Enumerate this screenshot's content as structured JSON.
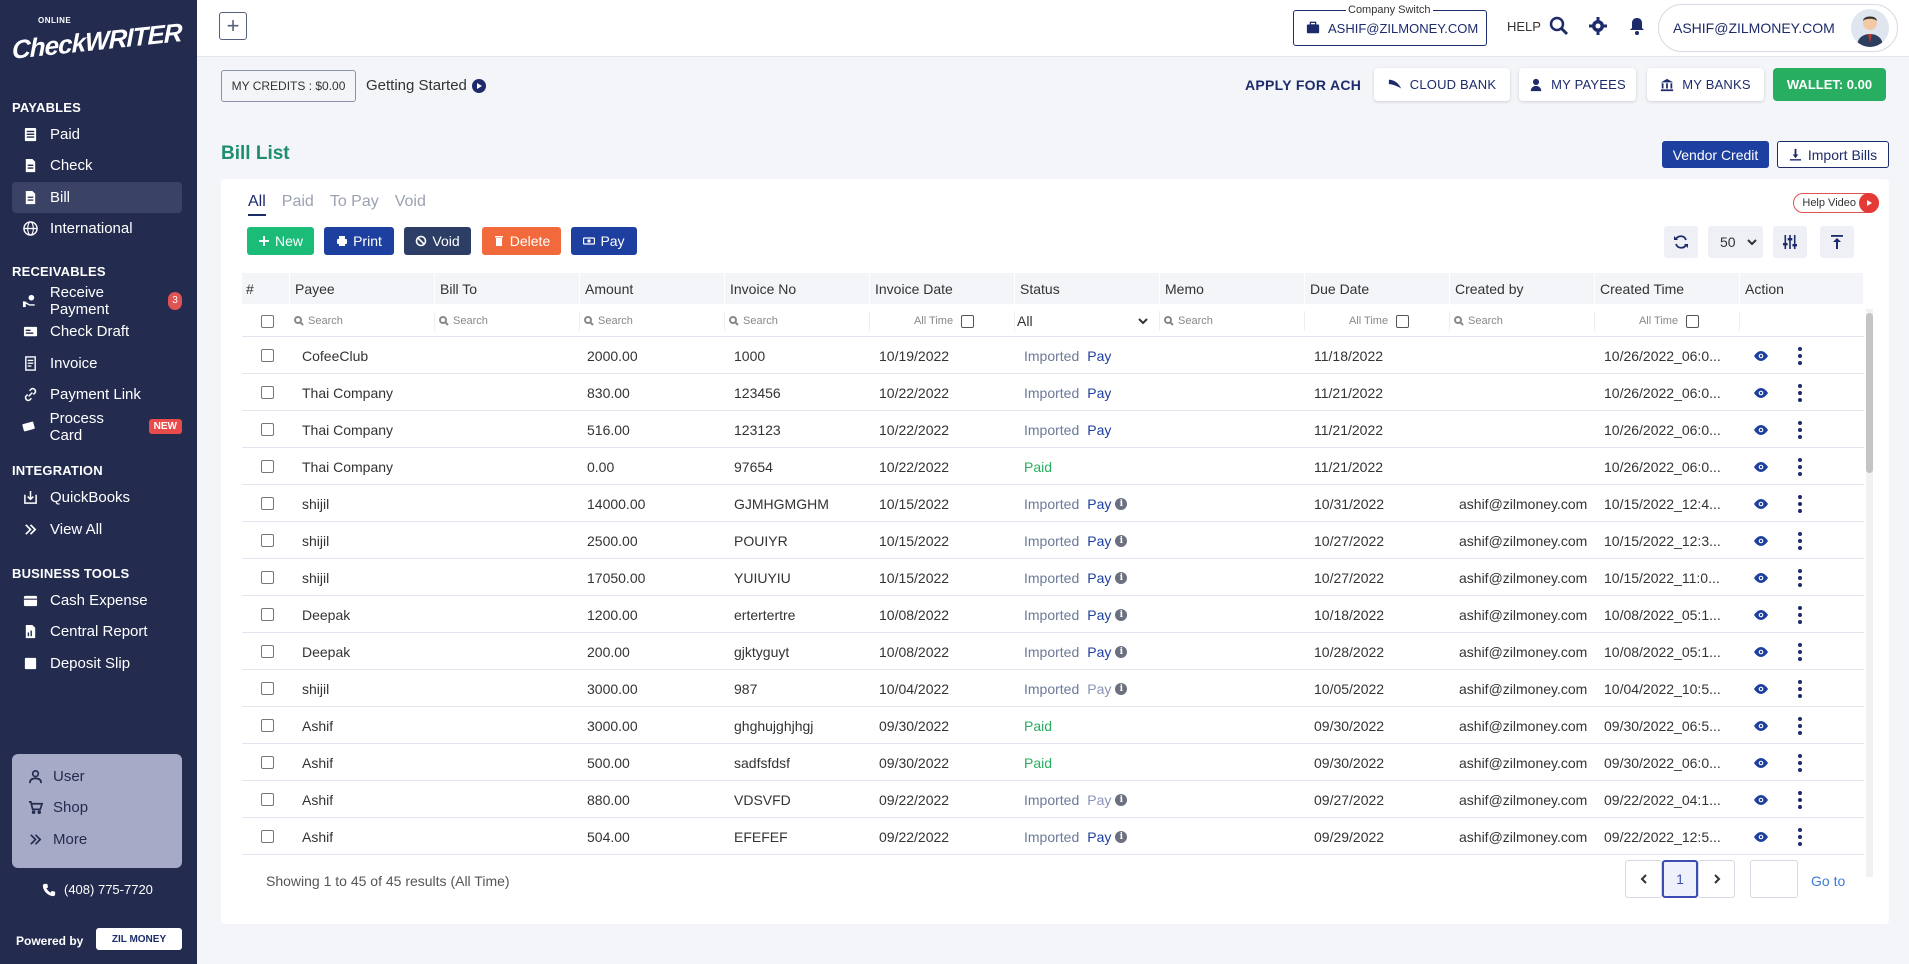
{
  "sidebar": {
    "logo_top": "ONLINE",
    "logo_brand": "CheckWRITER",
    "sections": {
      "payables": "PAYABLES",
      "receivables": "RECEIVABLES",
      "integration": "INTEGRATION",
      "business_tools": "BUSINESS TOOLS"
    },
    "items": {
      "paid": "Paid",
      "check": "Check",
      "bill": "Bill",
      "international": "International",
      "receive_payment": "Receive Payment",
      "receive_payment_count": "3",
      "check_draft": "Check Draft",
      "invoice": "Invoice",
      "payment_link": "Payment Link",
      "process_card": "Process Card",
      "process_card_badge": "NEW",
      "quickbooks": "QuickBooks",
      "view_all": "View All",
      "cash_expense": "Cash Expense",
      "central_report": "Central Report",
      "deposit_slip": "Deposit Slip"
    },
    "panel": {
      "user": "User",
      "shop": "Shop",
      "more": "More"
    },
    "phone": "(408) 775-7720",
    "powered_by": "Powered by",
    "zil": "ZIL MONEY"
  },
  "topbar": {
    "company_switch_label": "Company Switch",
    "company_email": "ASHIF@ZILMONEY.COM",
    "help": "HELP",
    "user_email": "ASHIF@ZILMONEY.COM"
  },
  "subbar": {
    "credits": "MY CREDITS : $0.00",
    "getting_started": "Getting Started",
    "apply_ach": "APPLY FOR ACH",
    "cloud_bank": "CLOUD BANK",
    "my_payees": "MY PAYEES",
    "my_banks": "MY BANKS",
    "wallet": "WALLET: 0.00"
  },
  "page": {
    "title": "Bill List",
    "vendor_credit": "Vendor Credit",
    "import_bills": "Import Bills",
    "help_video": "Help Video",
    "tabs": [
      "All",
      "Paid",
      "To Pay",
      "Void"
    ],
    "actions": {
      "new": "New",
      "print": "Print",
      "void": "Void",
      "delete": "Delete",
      "pay": "Pay"
    },
    "page_size": "50",
    "colors": {
      "new": "#1abc78",
      "print": "#1d3fa0",
      "void": "#2c3e66",
      "delete": "#f26a3b",
      "pay": "#1d3fa0"
    }
  },
  "table": {
    "headers": [
      "#",
      "Payee",
      "Bill To",
      "Amount",
      "Invoice No",
      "Invoice Date",
      "Status",
      "Memo",
      "Due Date",
      "Created by",
      "Created Time",
      "Action"
    ],
    "search_placeholder": "Search",
    "all_time": "All Time",
    "status_filter": "All",
    "pay_label": "Pay",
    "rows": [
      {
        "payee": "CofeeClub",
        "amount": "2000.00",
        "invoice_no": "1000",
        "invoice_date": "10/19/2022",
        "status": "Imported",
        "pay": true,
        "pay_dim": false,
        "info": false,
        "due": "11/18/2022",
        "created_by": "",
        "created_time": "10/26/2022_06:0..."
      },
      {
        "payee": "Thai Company",
        "amount": "830.00",
        "invoice_no": "123456",
        "invoice_date": "10/22/2022",
        "status": "Imported",
        "pay": true,
        "pay_dim": false,
        "info": false,
        "due": "11/21/2022",
        "created_by": "",
        "created_time": "10/26/2022_06:0..."
      },
      {
        "payee": "Thai Company",
        "amount": "516.00",
        "invoice_no": "123123",
        "invoice_date": "10/22/2022",
        "status": "Imported",
        "pay": true,
        "pay_dim": false,
        "info": false,
        "due": "11/21/2022",
        "created_by": "",
        "created_time": "10/26/2022_06:0..."
      },
      {
        "payee": "Thai Company",
        "amount": "0.00",
        "invoice_no": "97654",
        "invoice_date": "10/22/2022",
        "status": "Paid",
        "pay": false,
        "pay_dim": false,
        "info": false,
        "due": "11/21/2022",
        "created_by": "",
        "created_time": "10/26/2022_06:0..."
      },
      {
        "payee": "shijil",
        "amount": "14000.00",
        "invoice_no": "GJMHGMGHM",
        "invoice_date": "10/15/2022",
        "status": "Imported",
        "pay": true,
        "pay_dim": false,
        "info": true,
        "due": "10/31/2022",
        "created_by": "ashif@zilmoney.com",
        "created_time": "10/15/2022_12:4..."
      },
      {
        "payee": "shijil",
        "amount": "2500.00",
        "invoice_no": "POUIYR",
        "invoice_date": "10/15/2022",
        "status": "Imported",
        "pay": true,
        "pay_dim": false,
        "info": true,
        "due": "10/27/2022",
        "created_by": "ashif@zilmoney.com",
        "created_time": "10/15/2022_12:3..."
      },
      {
        "payee": "shijil",
        "amount": "17050.00",
        "invoice_no": "YUIUYIU",
        "invoice_date": "10/15/2022",
        "status": "Imported",
        "pay": true,
        "pay_dim": false,
        "info": true,
        "due": "10/27/2022",
        "created_by": "ashif@zilmoney.com",
        "created_time": "10/15/2022_11:0..."
      },
      {
        "payee": "Deepak",
        "amount": "1200.00",
        "invoice_no": "ertertertre",
        "invoice_date": "10/08/2022",
        "status": "Imported",
        "pay": true,
        "pay_dim": false,
        "info": true,
        "due": "10/18/2022",
        "created_by": "ashif@zilmoney.com",
        "created_time": "10/08/2022_05:1..."
      },
      {
        "payee": "Deepak",
        "amount": "200.00",
        "invoice_no": "gjktyguyt",
        "invoice_date": "10/08/2022",
        "status": "Imported",
        "pay": true,
        "pay_dim": false,
        "info": true,
        "due": "10/28/2022",
        "created_by": "ashif@zilmoney.com",
        "created_time": "10/08/2022_05:1..."
      },
      {
        "payee": "shijil",
        "amount": "3000.00",
        "invoice_no": "987",
        "invoice_date": "10/04/2022",
        "status": "Imported",
        "pay": true,
        "pay_dim": true,
        "info": true,
        "due": "10/05/2022",
        "created_by": "ashif@zilmoney.com",
        "created_time": "10/04/2022_10:5..."
      },
      {
        "payee": "Ashif",
        "amount": "3000.00",
        "invoice_no": "ghghujghjhgj",
        "invoice_date": "09/30/2022",
        "status": "Paid",
        "pay": false,
        "pay_dim": false,
        "info": false,
        "due": "09/30/2022",
        "created_by": "ashif@zilmoney.com",
        "created_time": "09/30/2022_06:5..."
      },
      {
        "payee": "Ashif",
        "amount": "500.00",
        "invoice_no": "sadfsfdsf",
        "invoice_date": "09/30/2022",
        "status": "Paid",
        "pay": false,
        "pay_dim": false,
        "info": false,
        "due": "09/30/2022",
        "created_by": "ashif@zilmoney.com",
        "created_time": "09/30/2022_06:0..."
      },
      {
        "payee": "Ashif",
        "amount": "880.00",
        "invoice_no": "VDSVFD",
        "invoice_date": "09/22/2022",
        "status": "Imported",
        "pay": true,
        "pay_dim": true,
        "info": true,
        "due": "09/27/2022",
        "created_by": "ashif@zilmoney.com",
        "created_time": "09/22/2022_04:1..."
      },
      {
        "payee": "Ashif",
        "amount": "504.00",
        "invoice_no": "EFEFEF",
        "invoice_date": "09/22/2022",
        "status": "Imported",
        "pay": true,
        "pay_dim": false,
        "info": true,
        "due": "09/29/2022",
        "created_by": "ashif@zilmoney.com",
        "created_time": "09/22/2022_12:5..."
      }
    ]
  },
  "footer": {
    "showing": "Showing 1 to 45 of 45 results (All Time)",
    "current_page": "1",
    "goto": "Go to"
  }
}
